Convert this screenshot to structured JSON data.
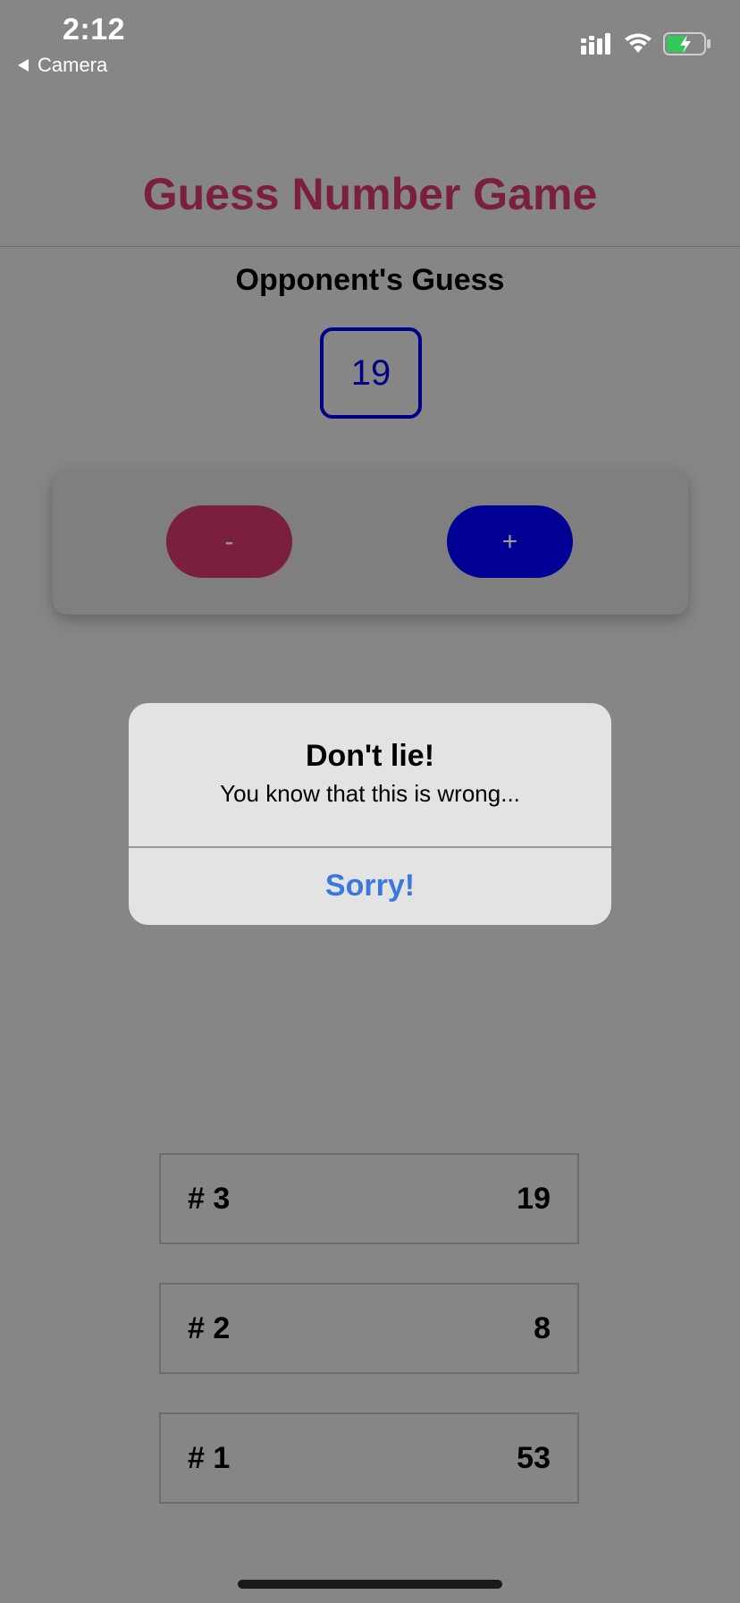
{
  "status_bar": {
    "time": "2:12",
    "back_label": "Camera"
  },
  "header": {
    "title": "Guess Number Game"
  },
  "game": {
    "opponent_label": "Opponent's Guess",
    "current_guess": "19",
    "minus_label": "-",
    "plus_label": "+"
  },
  "alert": {
    "title": "Don't lie!",
    "message": "You know that this is wrong...",
    "button_label": "Sorry!"
  },
  "rounds": [
    {
      "label": "# 3",
      "value": "19"
    },
    {
      "label": "# 2",
      "value": "8"
    },
    {
      "label": "# 1",
      "value": "53"
    }
  ],
  "colors": {
    "title": "#7a1f40",
    "accent_primary": "#000094",
    "accent_secondary": "#7a1f40",
    "alert_button": "#3a78e0",
    "overlay_bg": "#868686"
  }
}
